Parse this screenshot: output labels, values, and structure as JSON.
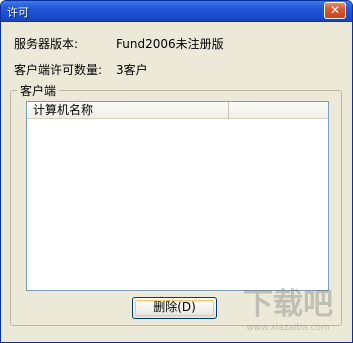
{
  "window": {
    "title": "许可",
    "close_label": "✕"
  },
  "info": {
    "server_version_label": "服务器版本:",
    "server_version_value": "Fund2006未注册版",
    "license_count_label": "客户端许可数量:",
    "license_count_value": "3客户"
  },
  "clients_group": {
    "caption": "客户端",
    "list": {
      "columns": [
        "计算机名称",
        ""
      ],
      "rows": []
    }
  },
  "buttons": {
    "delete_label": "删除(D)"
  },
  "watermark": {
    "text": "下载吧",
    "subtext": "www.xiazaiba.com"
  },
  "colors": {
    "titlebar": "#2458d8",
    "dialog_bg": "#ece9d8",
    "list_border": "#7f9db9",
    "button_border": "#003c74"
  }
}
